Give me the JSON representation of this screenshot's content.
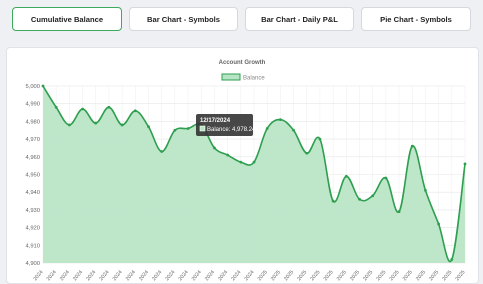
{
  "tabs": [
    {
      "label": "Cumulative Balance",
      "active": true
    },
    {
      "label": "Bar Chart - Symbols",
      "active": false
    },
    {
      "label": "Bar Chart - Daily P&L",
      "active": false
    },
    {
      "label": "Pie Chart - Symbols",
      "active": false
    }
  ],
  "colors": {
    "accent": "#3daa5b",
    "line": "#2e9e4f",
    "fill": "#b7e4c4",
    "tooltip_bg": "#333333"
  },
  "tooltip": {
    "title": "12/17/2024",
    "label": "Balance: 4,978.24"
  },
  "chart_data": {
    "type": "area",
    "title": "Account Growth",
    "legend": "top-center",
    "grid": true,
    "ylim": [
      4900,
      5000
    ],
    "yticks": [
      "5,000",
      "4,990",
      "4,980",
      "4,970",
      "4,960",
      "4,950",
      "4,940",
      "4,930",
      "4,920",
      "4,910",
      "4,900"
    ],
    "series": [
      {
        "name": "Balance",
        "values": [
          5000,
          4988,
          4978,
          4987,
          4979,
          4988,
          4978,
          4986,
          4977,
          4963,
          4975,
          4976,
          4978,
          4965,
          4961,
          4957,
          4957,
          4976,
          4981,
          4975,
          4962,
          4970,
          4935,
          4949,
          4936,
          4938,
          4948,
          4929,
          4966,
          4941,
          4922,
          4902,
          4956
        ]
      }
    ],
    "x": [
      "2024",
      "2024",
      "2024",
      "2024",
      "2024",
      "2024",
      "2024",
      "2024",
      "2024",
      "2024",
      "2024",
      "2024",
      "2024",
      "2024",
      "2024",
      "2024",
      "2024",
      "2025",
      "2025",
      "2025",
      "2025",
      "2025",
      "2025",
      "2025",
      "2025",
      "2025",
      "2025",
      "2025",
      "2025",
      "2025",
      "2025",
      "2025",
      "2025"
    ]
  }
}
